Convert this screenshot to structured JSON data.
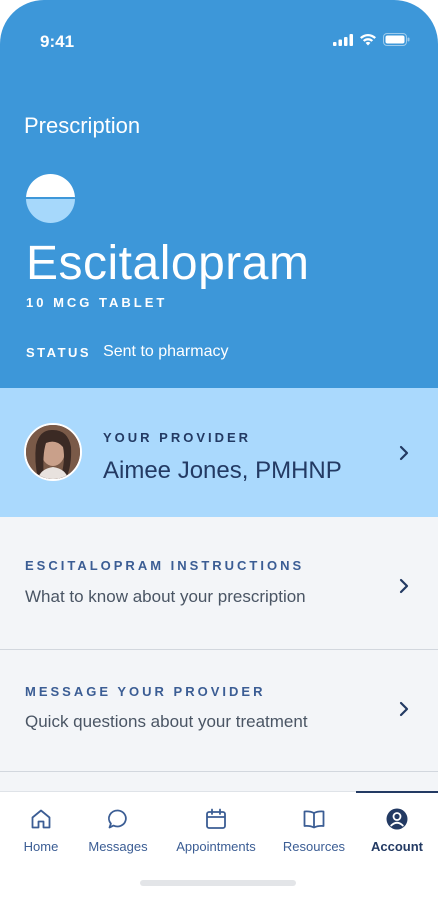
{
  "status_bar": {
    "time": "9:41"
  },
  "prescription": {
    "label": "Prescription",
    "drug_name": "Escitalopram",
    "dose": "10 MCG TABLET",
    "status_label": "STATUS",
    "status_value": "Sent to pharmacy"
  },
  "provider": {
    "label": "YOUR PROVIDER",
    "name": "Aimee Jones, PMHNP"
  },
  "sections": [
    {
      "title": "ESCITALOPRAM INSTRUCTIONS",
      "subtitle": "What to know about your prescription"
    },
    {
      "title": "MESSAGE YOUR PROVIDER",
      "subtitle": "Quick questions about your treatment"
    }
  ],
  "tabs": [
    {
      "label": "Home",
      "icon": "home-icon"
    },
    {
      "label": "Messages",
      "icon": "chat-bubble-icon"
    },
    {
      "label": "Appointments",
      "icon": "calendar-icon"
    },
    {
      "label": "Resources",
      "icon": "book-icon"
    },
    {
      "label": "Account",
      "icon": "account-icon",
      "active": true
    }
  ],
  "colors": {
    "hero_blue": "#3d97d9",
    "provider_bg": "#aad9fd",
    "navy": "#233a63",
    "accent": "#3b5d94"
  }
}
